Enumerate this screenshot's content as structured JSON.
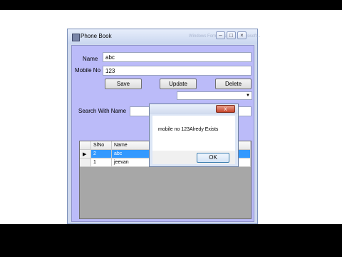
{
  "window": {
    "title": "Phone Book",
    "ghost_title": "Windows Form Designer - Microsoft...",
    "controls": {
      "minimize": "–",
      "maximize": "□",
      "close": "×"
    }
  },
  "form": {
    "name_label": "Name",
    "name_value": "abc",
    "mobile_label": "Mobile No",
    "mobile_value": "123",
    "save_label": "Save",
    "update_label": "Update",
    "delete_label": "Delete",
    "combo_value": "",
    "search_label": "Search With Name",
    "search_value": ""
  },
  "grid": {
    "columns": [
      "SlNo",
      "Name"
    ],
    "rows": [
      {
        "slno": "2",
        "name": "abc",
        "selected": true
      },
      {
        "slno": "1",
        "name": "jeevan",
        "selected": false
      }
    ]
  },
  "dialog": {
    "close_glyph": "x",
    "message": "mobile no 123Alredy Exists",
    "ok_label": "OK"
  },
  "colors": {
    "client_bg": "#bbbbf9",
    "grid_bg": "#a7a7a7",
    "selected_row": "#3399ff",
    "close_button": "#c6442b"
  }
}
